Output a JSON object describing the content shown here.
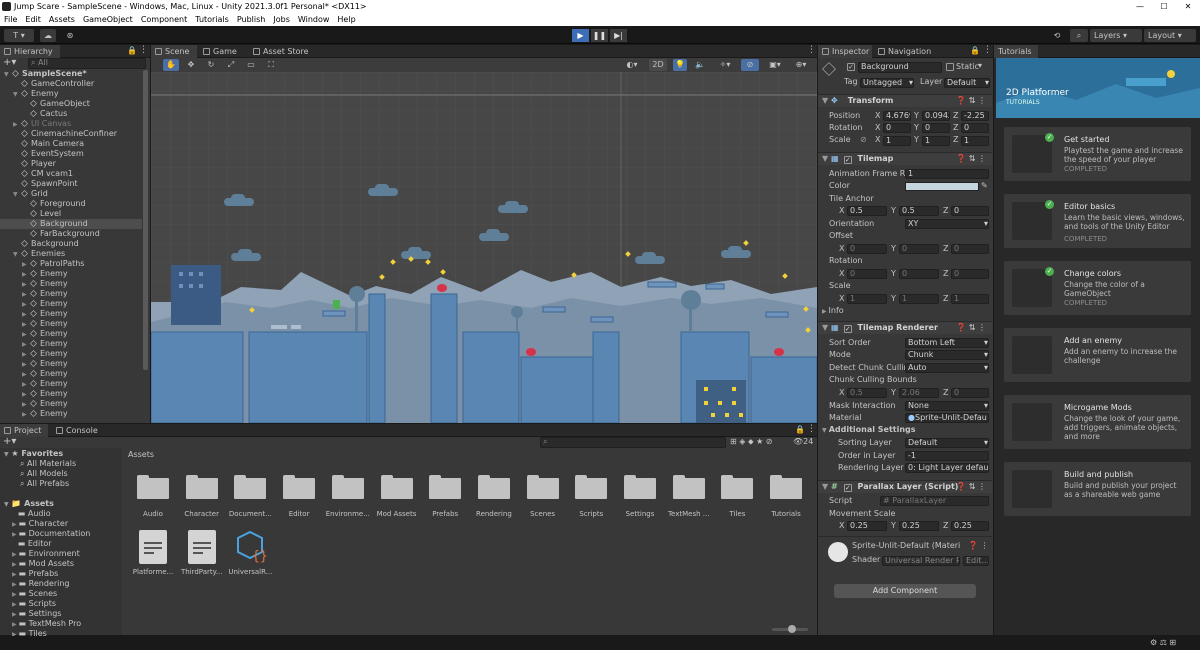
{
  "window": {
    "title": "Jump Scare - SampleScene - Windows, Mac, Linux - Unity 2021.3.0f1 Personal* <DX11>",
    "controls": [
      "—",
      "☐",
      "✕"
    ]
  },
  "menu": [
    "File",
    "Edit",
    "Assets",
    "GameObject",
    "Component",
    "Tutorials",
    "Publish",
    "Jobs",
    "Window",
    "Help"
  ],
  "toolbar": {
    "account": "T ▾",
    "layers": "Layers",
    "layout": "Layout"
  },
  "hierarchy": {
    "tab": "Hierarchy",
    "search_placeholder": "All",
    "rows": [
      {
        "label": "SampleScene*",
        "depth": 0,
        "arrow": "▼"
      },
      {
        "label": "GameController",
        "depth": 1,
        "arrow": ""
      },
      {
        "label": "Enemy",
        "depth": 1,
        "arrow": "▼"
      },
      {
        "label": "GameObject",
        "depth": 2,
        "arrow": ""
      },
      {
        "label": "Cactus",
        "depth": 2,
        "arrow": ""
      },
      {
        "label": "UI Canvas",
        "depth": 1,
        "arrow": "▶"
      },
      {
        "label": "CinemachineConfiner",
        "depth": 1,
        "arrow": ""
      },
      {
        "label": "Main Camera",
        "depth": 1,
        "arrow": ""
      },
      {
        "label": "EventSystem",
        "depth": 1,
        "arrow": ""
      },
      {
        "label": "Player",
        "depth": 1,
        "arrow": ""
      },
      {
        "label": "CM vcam1",
        "depth": 1,
        "arrow": ""
      },
      {
        "label": "SpawnPoint",
        "depth": 1,
        "arrow": ""
      },
      {
        "label": "Grid",
        "depth": 1,
        "arrow": "▼"
      },
      {
        "label": "Foreground",
        "depth": 2,
        "arrow": ""
      },
      {
        "label": "Level",
        "depth": 2,
        "arrow": ""
      },
      {
        "label": "Background",
        "depth": 2,
        "arrow": ""
      },
      {
        "label": "FarBackground",
        "depth": 2,
        "arrow": ""
      },
      {
        "label": "Background",
        "depth": 1,
        "arrow": ""
      },
      {
        "label": "Enemies",
        "depth": 1,
        "arrow": "▼"
      },
      {
        "label": "PatrolPaths",
        "depth": 2,
        "arrow": "▶"
      },
      {
        "label": "Enemy",
        "depth": 2,
        "arrow": "▶"
      },
      {
        "label": "Enemy",
        "depth": 2,
        "arrow": "▶"
      },
      {
        "label": "Enemy",
        "depth": 2,
        "arrow": "▶"
      },
      {
        "label": "Enemy",
        "depth": 2,
        "arrow": "▶"
      },
      {
        "label": "Enemy",
        "depth": 2,
        "arrow": "▶"
      },
      {
        "label": "Enemy",
        "depth": 2,
        "arrow": "▶"
      },
      {
        "label": "Enemy",
        "depth": 2,
        "arrow": "▶"
      },
      {
        "label": "Enemy",
        "depth": 2,
        "arrow": "▶"
      },
      {
        "label": "Enemy",
        "depth": 2,
        "arrow": "▶"
      },
      {
        "label": "Enemy",
        "depth": 2,
        "arrow": "▶"
      },
      {
        "label": "Enemy",
        "depth": 2,
        "arrow": "▶"
      },
      {
        "label": "Enemy",
        "depth": 2,
        "arrow": "▶"
      },
      {
        "label": "Enemy",
        "depth": 2,
        "arrow": "▶"
      },
      {
        "label": "Enemy",
        "depth": 2,
        "arrow": "▶"
      },
      {
        "label": "Enemy",
        "depth": 2,
        "arrow": "▶"
      }
    ]
  },
  "scene": {
    "tabs": [
      "Scene",
      "Game",
      "Asset Store"
    ],
    "mode_2d": "2D"
  },
  "inspector": {
    "tabs": [
      "Inspector",
      "Navigation"
    ],
    "object_name": "Background",
    "static_label": "Static",
    "tag_label": "Tag",
    "tag_value": "Untagged",
    "layer_label": "Layer",
    "layer_value": "Default",
    "transform": {
      "title": "Transform",
      "position_label": "Position",
      "pos_x": "4.6769",
      "pos_y": "0.0942",
      "pos_z": "-2.25",
      "rotation_label": "Rotation",
      "rot_x": "0",
      "rot_y": "0",
      "rot_z": "0",
      "scale_label": "Scale",
      "sc_x": "1",
      "sc_y": "1",
      "sc_z": "1"
    },
    "tilemap": {
      "title": "Tilemap",
      "frame_rate_label": "Animation Frame Rate",
      "frame_rate": "1",
      "color_label": "Color",
      "color_value": "#c5d6df",
      "anchor_label": "Tile Anchor",
      "anchor_x": "0.5",
      "anchor_y": "0.5",
      "anchor_z": "0",
      "orientation_label": "Orientation",
      "orientation": "XY",
      "offset_label": "Offset",
      "off_x": "0",
      "off_y": "0",
      "off_z": "0",
      "rotation_label": "Rotation",
      "r_x": "0",
      "r_y": "0",
      "r_z": "0",
      "scale_label": "Scale",
      "s_x": "1",
      "s_y": "1",
      "s_z": "1",
      "info_label": "Info"
    },
    "renderer": {
      "title": "Tilemap Renderer",
      "sort_label": "Sort Order",
      "sort": "Bottom Left",
      "mode_label": "Mode",
      "mode": "Chunk",
      "culling_label": "Detect Chunk Culling",
      "culling": "Auto",
      "bounds_label": "Chunk Culling Bounds",
      "b_x": "0.5",
      "b_y": "2.06",
      "b_z": "0",
      "mask_label": "Mask Interaction",
      "mask": "None",
      "material_label": "Material",
      "material": "Sprite-Unlit-Defau",
      "additional_label": "Additional Settings",
      "sorting_layer_label": "Sorting Layer",
      "sorting_layer": "Default",
      "order_label": "Order in Layer",
      "order": "-1",
      "render_layer_label": "Rendering Layer M",
      "render_layer": "0: Light Layer default"
    },
    "parallax": {
      "title": "Parallax Layer (Script)",
      "script_label": "Script",
      "script": "ParallaxLayer",
      "movement_label": "Movement Scale",
      "m_x": "0.25",
      "m_y": "0.25",
      "m_z": "0.25"
    },
    "material": {
      "name": "Sprite-Unlit-Default (Materi",
      "shader_label": "Shader",
      "shader": "Universal Render P",
      "edit": "Edit..."
    },
    "add_component": "Add Component"
  },
  "tutorials": {
    "tab": "Tutorials",
    "banner_title": "2D Platformer",
    "banner_sub": "TUTORIALS",
    "cards": [
      {
        "title": "Get started",
        "desc": "Playtest the game and increase the speed of your player",
        "status": "COMPLETED"
      },
      {
        "title": "Editor basics",
        "desc": "Learn the basic views, windows, and tools of the Unity Editor",
        "status": "COMPLETED"
      },
      {
        "title": "Change colors",
        "desc": "Change the color of a GameObject",
        "status": "COMPLETED"
      },
      {
        "title": "Add an enemy",
        "desc": "Add an enemy to increase the challenge",
        "status": ""
      },
      {
        "title": "Microgame Mods",
        "desc": "Change the look of your game, add triggers, animate objects, and more",
        "status": ""
      },
      {
        "title": "Build and publish",
        "desc": "Build and publish your project as a shareable web game",
        "status": ""
      }
    ]
  },
  "project": {
    "tabs": [
      "Project",
      "Console"
    ],
    "favorites_label": "Favorites",
    "favorites": [
      "All Materials",
      "All Models",
      "All Prefabs"
    ],
    "assets_label": "Assets",
    "tree": [
      "Audio",
      "Character",
      "Documentation",
      "Editor",
      "Environment",
      "Mod Assets",
      "Prefabs",
      "Rendering",
      "Scenes",
      "Scripts",
      "Settings",
      "TextMesh Pro",
      "Tiles"
    ],
    "breadcrumb": "Assets",
    "hidden_count": "24",
    "folders": [
      "Audio",
      "Character",
      "Document...",
      "Editor",
      "Environme...",
      "Mod Assets",
      "Prefabs",
      "Rendering",
      "Scenes",
      "Scripts",
      "Settings",
      "TextMesh ...",
      "Tiles",
      "Tutorials"
    ],
    "files": [
      "Platforme...",
      "ThirdParty...",
      "UniversalR..."
    ]
  }
}
